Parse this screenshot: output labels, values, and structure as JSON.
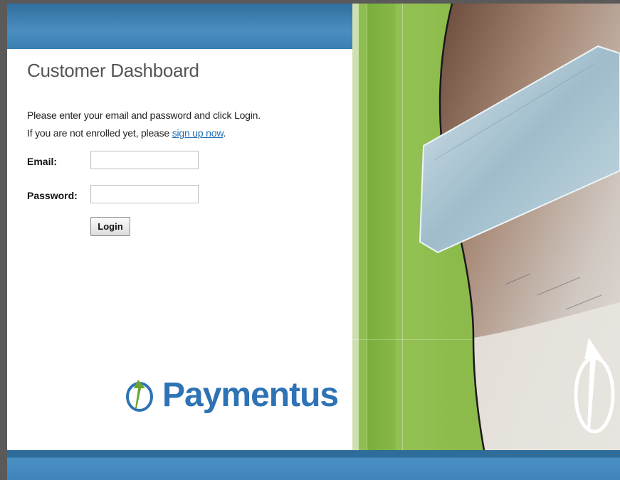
{
  "page": {
    "title": "Customer Dashboard",
    "intro_line1": "Please enter your email and password and click Login.",
    "intro_line2_prefix": "If you are not enrolled yet, please ",
    "signup_link": "sign up now",
    "intro_line2_suffix": "."
  },
  "form": {
    "email_label": "Email:",
    "email_value": "",
    "password_label": "Password:",
    "password_value": "",
    "login_button": "Login"
  },
  "brand": {
    "name": "Paymentus",
    "color": "#2d73b5",
    "mark_icon": "paymentus-swoosh-icon"
  },
  "colors": {
    "header_blue": "#3b7fb4",
    "panel_green": "#8cbb4c",
    "link_blue": "#1f6db0"
  }
}
